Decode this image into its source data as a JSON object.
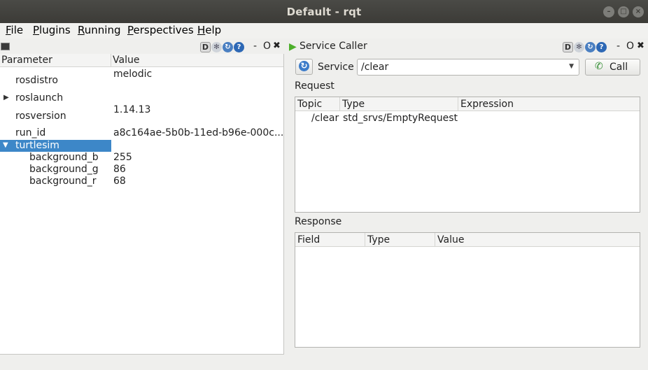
{
  "window": {
    "title": "Default - rqt"
  },
  "menu": [
    {
      "u": "F",
      "rest": "ile"
    },
    {
      "u": "P",
      "rest": "lugins"
    },
    {
      "u": "R",
      "rest": "unning"
    },
    {
      "u": "P",
      "rest": "erspectives"
    },
    {
      "u": "H",
      "rest": "elp"
    }
  ],
  "left_dock": {
    "d_label": "D",
    "dash": "-",
    "o_label": "O",
    "close": "✖"
  },
  "params": {
    "headers": {
      "name": "Parameter",
      "value": "Value"
    },
    "rows": [
      {
        "name": "rosdistro",
        "value": "melodic"
      },
      {
        "name": "roslaunch",
        "value": ""
      },
      {
        "name": "rosversion",
        "value": "1.14.13"
      },
      {
        "name": "run_id",
        "value": "a8c164ae-5b0b-11ed-b96e-000c..."
      },
      {
        "name": "turtlesim",
        "value": ""
      },
      {
        "name": "background_b",
        "value": "255"
      },
      {
        "name": "background_g",
        "value": "86"
      },
      {
        "name": "background_r",
        "value": "68"
      }
    ]
  },
  "service_caller": {
    "title": "Service Caller",
    "dock": {
      "d_label": "D",
      "dash": "-",
      "o_label": "O",
      "close": "✖"
    },
    "service_label": "Service",
    "service_value": "/clear",
    "call_label": "Call",
    "request_label": "Request",
    "request_headers": [
      "Topic",
      "Type",
      "Expression"
    ],
    "request_rows": [
      {
        "topic": "/clear",
        "type": "std_srvs/EmptyRequest",
        "expression": ""
      }
    ],
    "response_label": "Response",
    "response_headers": [
      "Field",
      "Type",
      "Value"
    ]
  }
}
